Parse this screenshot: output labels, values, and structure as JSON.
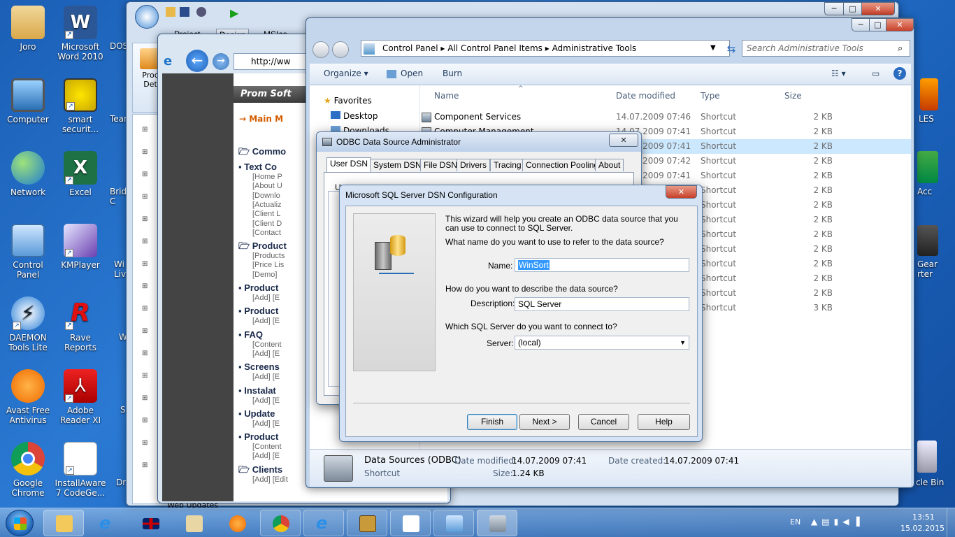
{
  "desktop": {
    "icons_left": [
      {
        "label": "Joro"
      },
      {
        "label": "Microsoft Word 2010"
      },
      {
        "label": "Computer"
      },
      {
        "label": "smart securit..."
      },
      {
        "label": "Network"
      },
      {
        "label": "Excel"
      },
      {
        "label": "Control Panel"
      },
      {
        "label": "KMPlayer"
      },
      {
        "label": "DAEMON Tools Lite"
      },
      {
        "label": "Rave Reports"
      },
      {
        "label": "Avast Free Antivirus"
      },
      {
        "label": "Adobe Reader XI"
      },
      {
        "label": "Google Chrome"
      },
      {
        "label": "InstallAware 7 CodeGe..."
      }
    ],
    "partial_left_labels": [
      "DOS",
      "Team",
      "Brid C",
      "Wi Liv",
      "W",
      "S",
      "Dr"
    ],
    "partial_right_labels": [
      "LES",
      "Acc",
      "Gear rter",
      "cle Bin"
    ]
  },
  "back_window": {
    "tabs": [
      "Project",
      "Design",
      "MSIco"
    ],
    "side_label": "Proc Det",
    "tree_item": "Web Updates"
  },
  "browser": {
    "address": "http://ww",
    "sidebar_title": "Prom Soft",
    "main_menu": "Main M",
    "sections": [
      {
        "title": "Commo",
        "bold": true
      },
      {
        "title": "Text Co",
        "links": [
          "[Home P",
          "[About U",
          "[Downlo",
          "[Actualiz",
          "[Client L",
          "[Client D",
          "[Contact"
        ]
      },
      {
        "title": "Product",
        "links": [
          "[Products",
          "[Price Lis",
          "[Demo]"
        ]
      },
      {
        "title": "Product",
        "links": [
          "[Add] [E"
        ]
      },
      {
        "title": "Product",
        "links": [
          "[Add] [E"
        ]
      },
      {
        "title": "FAQ",
        "links": [
          "[Content",
          "[Add] [E"
        ]
      },
      {
        "title": "Screens",
        "links": [
          "[Add] [E"
        ]
      },
      {
        "title": "Instalat",
        "links": [
          "[Add] [E"
        ]
      },
      {
        "title": "Update",
        "links": [
          "[Add] [E"
        ]
      },
      {
        "title": "Product",
        "links": [
          "[Content",
          "[Add] [E"
        ]
      },
      {
        "title": "Clients",
        "links": [
          "[Add] [Edit / Remove]"
        ]
      }
    ]
  },
  "explorer": {
    "breadcrumb": [
      "Control Panel",
      "All Control Panel Items",
      "Administrative Tools"
    ],
    "search_placeholder": "Search Administrative Tools",
    "toolbar": {
      "organize": "Organize",
      "open": "Open",
      "burn": "Burn"
    },
    "nav": {
      "favorites": "Favorites",
      "desktop": "Desktop",
      "downloads": "Downloads"
    },
    "columns": {
      "name": "Name",
      "date": "Date modified",
      "type": "Type",
      "size": "Size"
    },
    "rows": [
      {
        "name": "Component Services",
        "date": "14.07.2009 07:46",
        "type": "Shortcut",
        "size": "2 KB"
      },
      {
        "name": "Computer Management",
        "date": "14.07.2009 07:41",
        "type": "Shortcut",
        "size": "2 KB"
      },
      {
        "name": "Data Sources (ODBC)",
        "date": "14.07.2009 07:41",
        "type": "Shortcut",
        "size": "2 KB",
        "selected": true
      },
      {
        "name": "",
        "date": "14.07.2009 07:42",
        "type": "Shortcut",
        "size": "2 KB"
      },
      {
        "name": "",
        "date": "14.07.2009 07:41",
        "type": "Shortcut",
        "size": "2 KB"
      },
      {
        "name": "",
        "date": "",
        "type": "Shortcut",
        "size": "2 KB"
      },
      {
        "name": "",
        "date": "",
        "type": "Shortcut",
        "size": "2 KB"
      },
      {
        "name": "",
        "date": "",
        "type": "Shortcut",
        "size": "2 KB"
      },
      {
        "name": "",
        "date": "",
        "type": "Shortcut",
        "size": "2 KB"
      },
      {
        "name": "",
        "date": "",
        "type": "Shortcut",
        "size": "2 KB"
      },
      {
        "name": "",
        "date": "",
        "type": "Shortcut",
        "size": "2 KB"
      },
      {
        "name": "",
        "date": "",
        "type": "Shortcut",
        "size": "2 KB"
      },
      {
        "name": "",
        "date": "",
        "type": "Shortcut",
        "size": "2 KB"
      },
      {
        "name": "",
        "date": "",
        "type": "Shortcut",
        "size": "3 KB"
      }
    ],
    "details": {
      "name": "Data Sources (ODBC)",
      "type": "Shortcut",
      "modified_label": "Date modified:",
      "modified": "14.07.2009 07:41",
      "created_label": "Date created:",
      "created": "14.07.2009 07:41",
      "size_label": "Size:",
      "size": "1.24 KB"
    }
  },
  "odbc": {
    "title": "ODBC Data Source Administrator",
    "tabs": [
      "User DSN",
      "System DSN",
      "File DSN",
      "Drivers",
      "Tracing",
      "Connection Pooling",
      "About"
    ],
    "partial_label": "U"
  },
  "sql_dialog": {
    "title": "Microsoft SQL Server DSN Configuration",
    "intro": "This wizard will help you create an ODBC data source that you can use to connect to SQL Server.",
    "q_name": "What name do you want to use to refer to the data source?",
    "name_label": "Name:",
    "name_value": "WinSort",
    "q_desc": "How do you want to describe the data source?",
    "desc_label": "Description:",
    "desc_value": "SQL Server",
    "q_server": "Which SQL Server do you want to connect to?",
    "server_label": "Server:",
    "server_value": "(local)",
    "buttons": {
      "finish": "Finish",
      "next": "Next >",
      "cancel": "Cancel",
      "help": "Help"
    }
  },
  "taskbar": {
    "lang": "EN",
    "time": "13:51",
    "date": "15.02.2015"
  }
}
